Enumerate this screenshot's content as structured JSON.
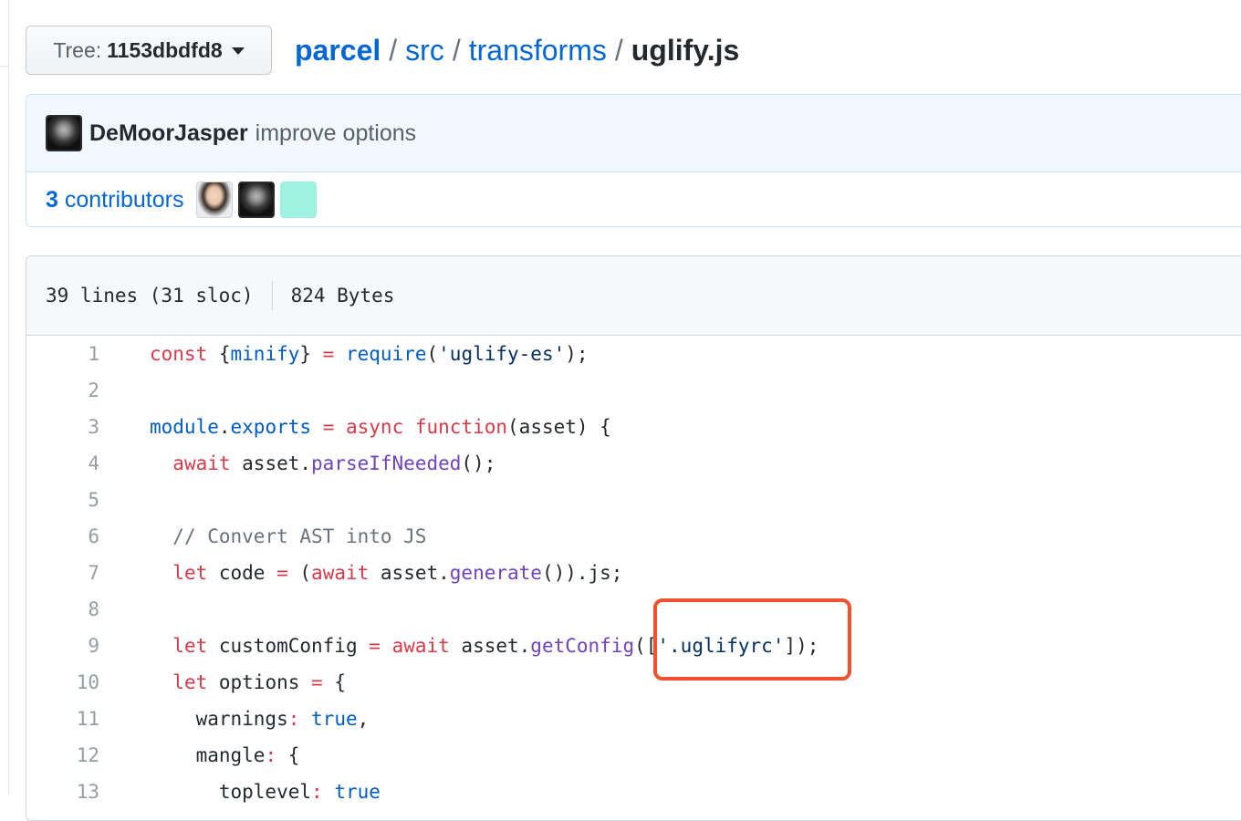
{
  "tree_button": {
    "prefix": "Tree:",
    "sha": "1153dbdfd8"
  },
  "breadcrumb": {
    "repo": "parcel",
    "dir1": "src",
    "dir2": "transforms",
    "file": "uglify.js",
    "separator": "/"
  },
  "commit": {
    "author": "DeMoorJasper",
    "message": "improve options"
  },
  "contributors": {
    "count": "3",
    "label": "contributors"
  },
  "file_info": {
    "lines": "39 lines (31 sloc)",
    "size": "824 Bytes"
  },
  "code": {
    "line_numbers": [
      "1",
      "2",
      "3",
      "4",
      "5",
      "6",
      "7",
      "8",
      "9",
      "10",
      "11",
      "12",
      "13"
    ],
    "lines": [
      [
        {
          "t": "const",
          "c": "k"
        },
        {
          "t": " {"
        },
        {
          "t": "minify",
          "c": "c1"
        },
        {
          "t": "} "
        },
        {
          "t": "=",
          "c": "k"
        },
        {
          "t": " "
        },
        {
          "t": "require",
          "c": "c1"
        },
        {
          "t": "("
        },
        {
          "t": "'uglify-es'",
          "c": "s"
        },
        {
          "t": ");"
        }
      ],
      [],
      [
        {
          "t": "module",
          "c": "c1"
        },
        {
          "t": "."
        },
        {
          "t": "exports",
          "c": "c1"
        },
        {
          "t": " "
        },
        {
          "t": "=",
          "c": "k"
        },
        {
          "t": " "
        },
        {
          "t": "async",
          "c": "k"
        },
        {
          "t": " "
        },
        {
          "t": "function",
          "c": "k"
        },
        {
          "t": "(asset) {"
        }
      ],
      [
        {
          "t": "  "
        },
        {
          "t": "await",
          "c": "k"
        },
        {
          "t": " asset."
        },
        {
          "t": "parseIfNeeded",
          "c": "e"
        },
        {
          "t": "();"
        }
      ],
      [],
      [
        {
          "t": "  "
        },
        {
          "t": "// Convert AST into JS",
          "c": "cm"
        }
      ],
      [
        {
          "t": "  "
        },
        {
          "t": "let",
          "c": "k"
        },
        {
          "t": " code "
        },
        {
          "t": "=",
          "c": "k"
        },
        {
          "t": " ("
        },
        {
          "t": "await",
          "c": "k"
        },
        {
          "t": " asset."
        },
        {
          "t": "generate",
          "c": "e"
        },
        {
          "t": "()).js;"
        }
      ],
      [],
      [
        {
          "t": "  "
        },
        {
          "t": "let",
          "c": "k"
        },
        {
          "t": " customConfig "
        },
        {
          "t": "=",
          "c": "k"
        },
        {
          "t": " "
        },
        {
          "t": "await",
          "c": "k"
        },
        {
          "t": " asset."
        },
        {
          "t": "getConfig",
          "c": "e"
        },
        {
          "t": "(["
        },
        {
          "t": "'.uglifyrc'",
          "c": "s"
        },
        {
          "t": "]);"
        }
      ],
      [
        {
          "t": "  "
        },
        {
          "t": "let",
          "c": "k"
        },
        {
          "t": " options "
        },
        {
          "t": "=",
          "c": "k"
        },
        {
          "t": " {"
        }
      ],
      [
        {
          "t": "    warnings"
        },
        {
          "t": ":",
          "c": "k"
        },
        {
          "t": " "
        },
        {
          "t": "true",
          "c": "c1"
        },
        {
          "t": ","
        }
      ],
      [
        {
          "t": "    mangle"
        },
        {
          "t": ":",
          "c": "k"
        },
        {
          "t": " {"
        }
      ],
      [
        {
          "t": "      toplevel"
        },
        {
          "t": ":",
          "c": "k"
        },
        {
          "t": " "
        },
        {
          "t": "true",
          "c": "c1"
        }
      ]
    ]
  },
  "colors": {
    "link": "#0366d6",
    "keyword": "#d73a49",
    "constant": "#005cc5",
    "entity": "#6f42c1",
    "string": "#032f62",
    "comment": "#6a737d",
    "highlight_box": "#f0522d"
  },
  "icons": {
    "tree_caret": "caret-down-icon",
    "author_avatar": "avatar",
    "contributor_avatars": [
      "avatar",
      "avatar",
      "avatar"
    ]
  }
}
